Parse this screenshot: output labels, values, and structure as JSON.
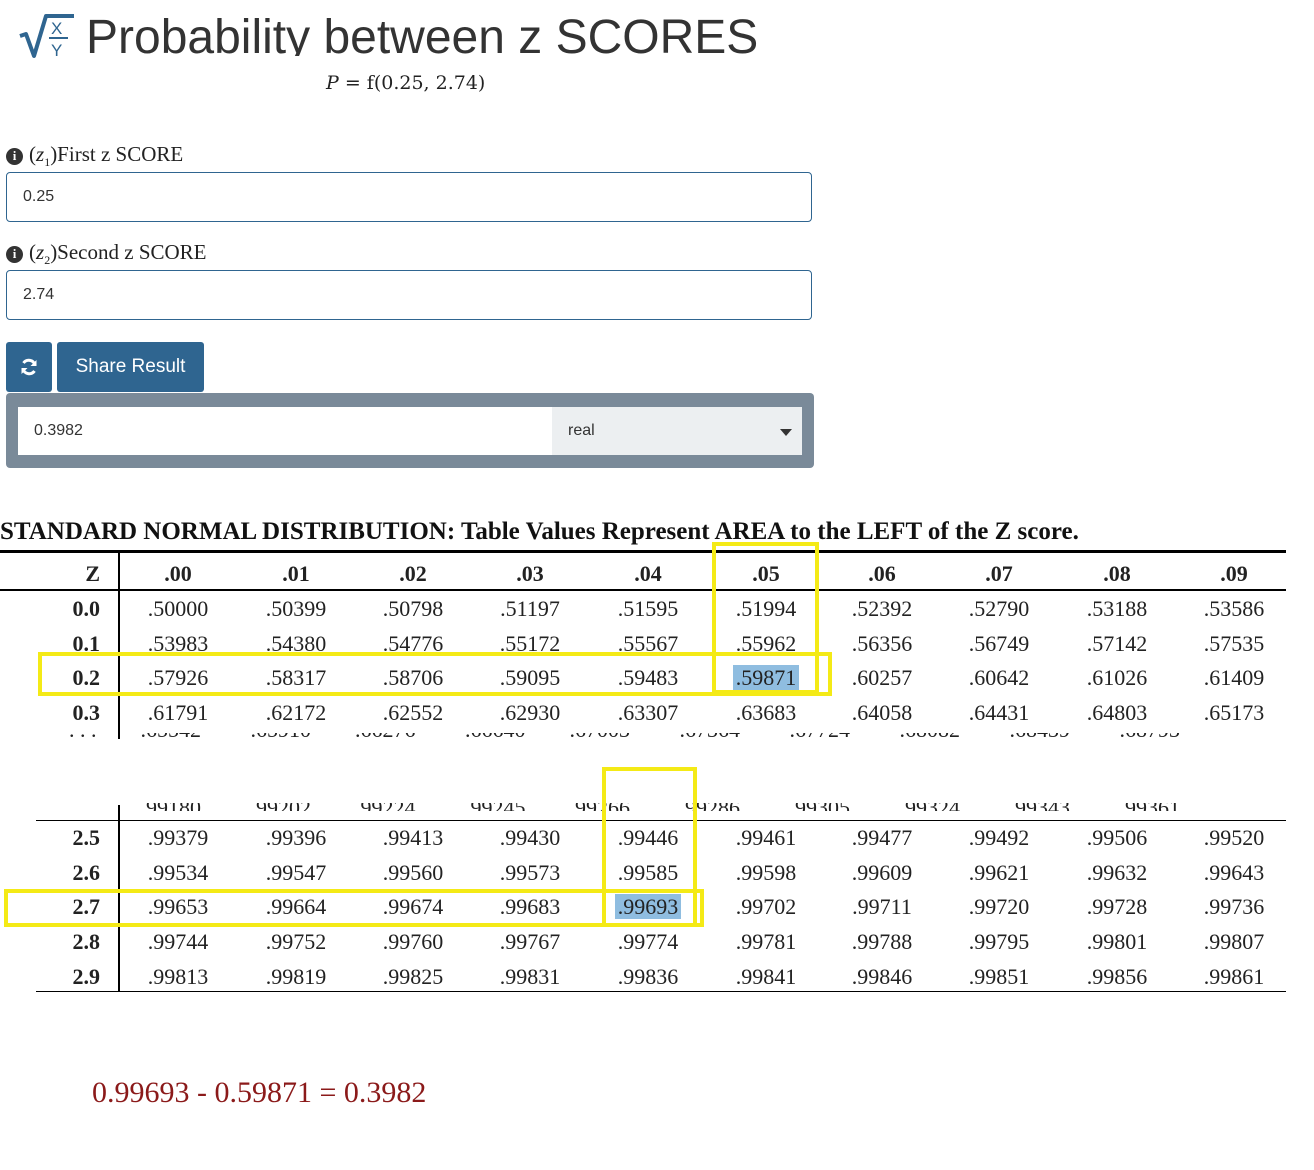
{
  "header": {
    "logo_icon": "sqrt-fraction-logo-icon",
    "title": "Probability between z SCORES",
    "formula_p": "P",
    "formula_rest": " = f(0.25, 2.74)"
  },
  "fields": {
    "first_label": ")First z SCORE",
    "first_sub": "1",
    "first_value": "0.25",
    "second_label": ")Second z SCORE",
    "second_sub": "2",
    "second_value": "2.74"
  },
  "buttons": {
    "refresh_icon": "refresh-icon",
    "share_label": "Share Result"
  },
  "result": {
    "value": "0.3982",
    "type_selected": "real"
  },
  "table": {
    "caption": "STANDARD NORMAL DISTRIBUTION: Table Values Represent AREA to the LEFT of the Z score.",
    "z_header": "Z",
    "columns": [
      ".00",
      ".01",
      ".02",
      ".03",
      ".04",
      ".05",
      ".06",
      ".07",
      ".08",
      ".09"
    ],
    "top_rows": [
      {
        "z": "0.0",
        "values": [
          ".50000",
          ".50399",
          ".50798",
          ".51197",
          ".51595",
          ".51994",
          ".52392",
          ".52790",
          ".53188",
          ".53586"
        ]
      },
      {
        "z": "0.1",
        "values": [
          ".53983",
          ".54380",
          ".54776",
          ".55172",
          ".55567",
          ".55962",
          ".56356",
          ".56749",
          ".57142",
          ".57535"
        ]
      },
      {
        "z": "0.2",
        "values": [
          ".57926",
          ".58317",
          ".58706",
          ".59095",
          ".59483",
          ".59871",
          ".60257",
          ".60642",
          ".61026",
          ".61409"
        ]
      },
      {
        "z": "0.3",
        "values": [
          ".61791",
          ".62172",
          ".62552",
          ".62930",
          ".63307",
          ".63683",
          ".64058",
          ".64431",
          ".64803",
          ".65173"
        ]
      }
    ],
    "bottom_rows": [
      {
        "z": "2.5",
        "values": [
          ".99379",
          ".99396",
          ".99413",
          ".99430",
          ".99446",
          ".99461",
          ".99477",
          ".99492",
          ".99506",
          ".99520"
        ]
      },
      {
        "z": "2.6",
        "values": [
          ".99534",
          ".99547",
          ".99560",
          ".99573",
          ".99585",
          ".99598",
          ".99609",
          ".99621",
          ".99632",
          ".99643"
        ]
      },
      {
        "z": "2.7",
        "values": [
          ".99653",
          ".99664",
          ".99674",
          ".99683",
          ".99693",
          ".99702",
          ".99711",
          ".99720",
          ".99728",
          ".99736"
        ]
      },
      {
        "z": "2.8",
        "values": [
          ".99744",
          ".99752",
          ".99760",
          ".99767",
          ".99774",
          ".99781",
          ".99788",
          ".99795",
          ".99801",
          ".99807"
        ]
      },
      {
        "z": "2.9",
        "values": [
          ".99813",
          ".99819",
          ".99825",
          ".99831",
          ".99836",
          ".99841",
          ".99846",
          ".99851",
          ".99856",
          ".99861"
        ]
      }
    ],
    "highlight_colors": {
      "box": "#f4ea16",
      "cell": "#8fbde0"
    }
  },
  "calculation": "0.99693 - 0.59871 = 0.3982"
}
